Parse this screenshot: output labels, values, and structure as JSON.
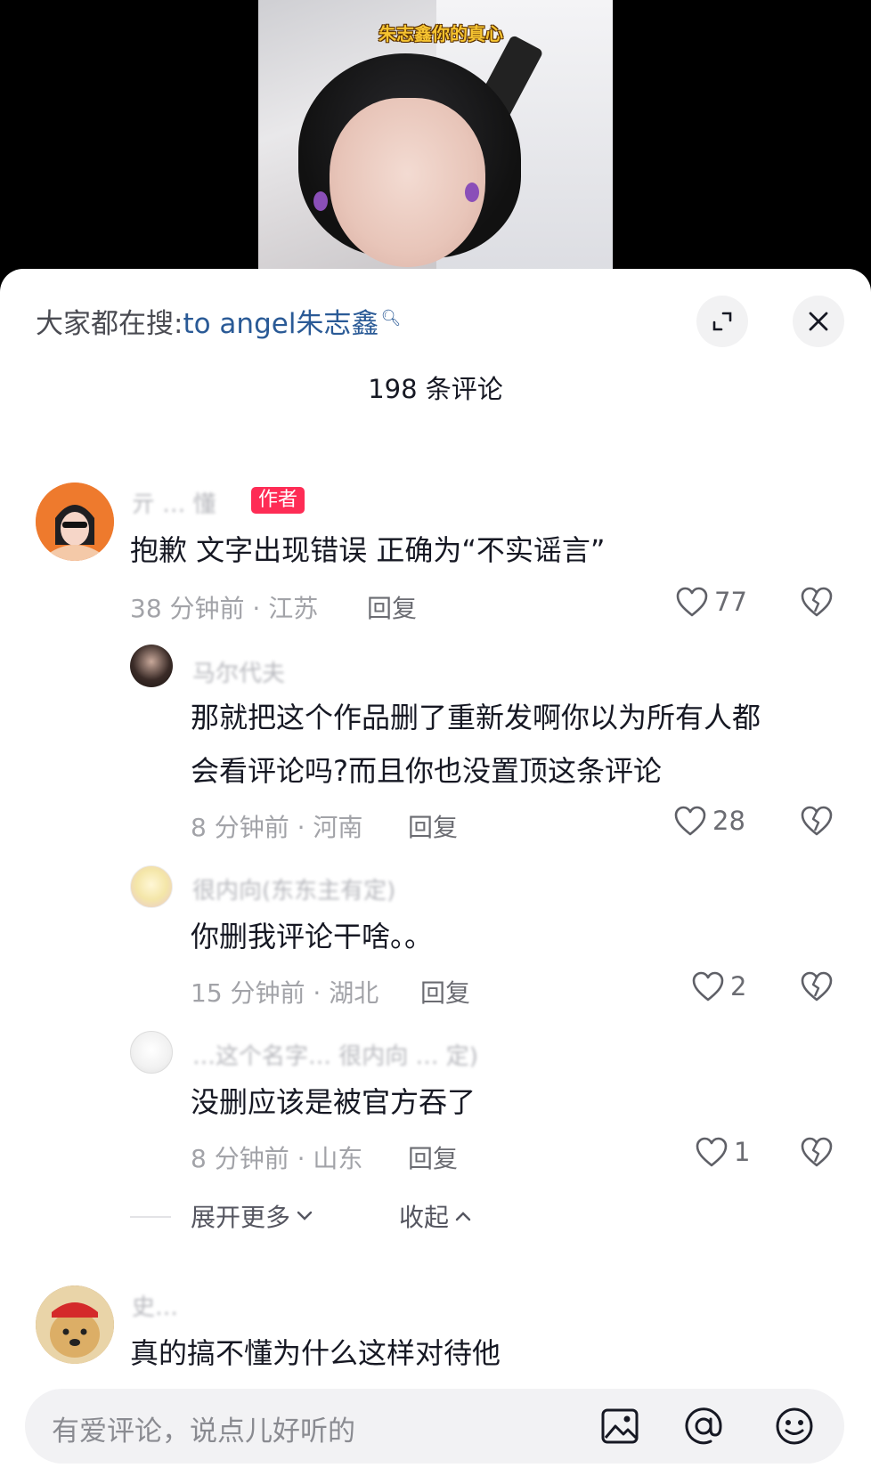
{
  "video": {
    "caption": "朱志鑫你的真心"
  },
  "sheet": {
    "search_prefix": "大家都在搜:",
    "search_term": "to angel朱志鑫",
    "title": "198 条评论"
  },
  "comments": [
    {
      "nickname": "亓 … 懂",
      "badge": "作者",
      "text": "抱歉 文字出现错误 正确为“不实谣言”",
      "meta": "38 分钟前 · 江苏",
      "reply": "回复",
      "likes": "77"
    },
    {
      "nickname": "马尔代夫",
      "text_lines": [
        "那就把这个作品删了重新发啊你以为所有人都",
        "会看评论吗?而且你也没置顶这条评论"
      ],
      "meta": "8 分钟前 · 河南",
      "reply": "回复",
      "likes": "28"
    },
    {
      "nickname": "很内向(东东主有定)",
      "text": "你删我评论干啥。。",
      "meta": "15 分钟前 · 湖北",
      "reply": "回复",
      "likes": "2"
    },
    {
      "nickname": "…这个名字… 很内向 … 定)",
      "text": "没删应该是被官方吞了",
      "meta": "8 分钟前 · 山东",
      "reply": "回复",
      "likes": "1"
    },
    {
      "nickname": "史… ",
      "text": "真的搞不懂为什么这样对待他"
    }
  ],
  "thread": {
    "expand_more": "展开更多",
    "collapse": "收起"
  },
  "input": {
    "placeholder": "有爱评论，说点儿好听的"
  },
  "icons": {
    "expand": "expand-icon",
    "close": "close-icon",
    "like": "heart-icon",
    "dislike": "broken-heart-icon",
    "image": "image-icon",
    "mention": "at-icon",
    "emoji": "emoji-icon"
  }
}
